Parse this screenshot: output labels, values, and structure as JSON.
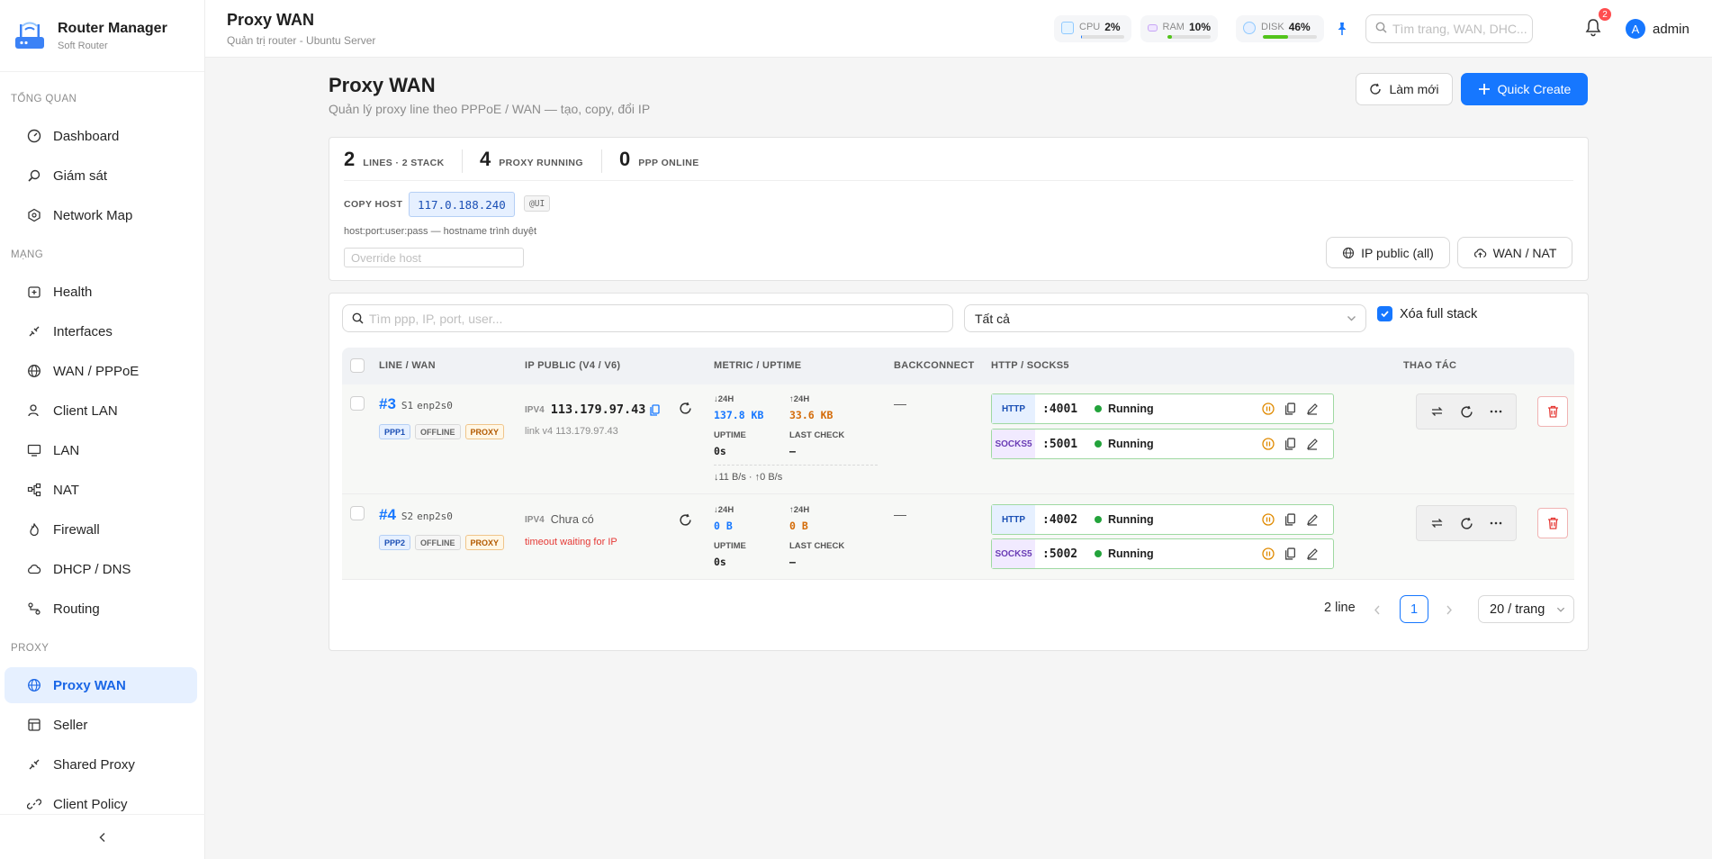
{
  "brand": {
    "title": "Router Manager",
    "subtitle": "Soft Router"
  },
  "sidebar": {
    "sections": [
      {
        "label": "TỔNG QUAN"
      },
      {
        "label": "MẠNG"
      },
      {
        "label": "PROXY"
      }
    ],
    "items": [
      {
        "label": "Dashboard",
        "icon": "dashboard-icon"
      },
      {
        "label": "Giám sát",
        "icon": "monitor-search-icon"
      },
      {
        "label": "Network Map",
        "icon": "network-map-icon"
      },
      {
        "label": "Health",
        "icon": "health-icon"
      },
      {
        "label": "Interfaces",
        "icon": "interfaces-icon"
      },
      {
        "label": "WAN / PPPoE",
        "icon": "globe-icon"
      },
      {
        "label": "Client LAN",
        "icon": "client-icon"
      },
      {
        "label": "LAN",
        "icon": "monitor-icon"
      },
      {
        "label": "NAT",
        "icon": "nat-icon"
      },
      {
        "label": "Firewall",
        "icon": "fire-icon"
      },
      {
        "label": "DHCP / DNS",
        "icon": "cloud-icon"
      },
      {
        "label": "Routing",
        "icon": "routing-icon"
      },
      {
        "label": "Proxy WAN",
        "icon": "globe-icon"
      },
      {
        "label": "Seller",
        "icon": "seller-icon"
      },
      {
        "label": "Shared Proxy",
        "icon": "shared-icon"
      },
      {
        "label": "Client Policy",
        "icon": "link-icon"
      }
    ],
    "active": "Proxy WAN"
  },
  "header": {
    "title": "Proxy WAN",
    "subtitle": "Quản trị router - Ubuntu Server",
    "stats": [
      {
        "label": "CPU",
        "value": "2%",
        "percent": 2,
        "color": "#1677ff"
      },
      {
        "label": "RAM",
        "value": "10%",
        "percent": 10,
        "color": "#52c41a"
      },
      {
        "label": "DISK",
        "value": "46%",
        "percent": 46,
        "color": "#52c41a"
      }
    ],
    "search_placeholder": "Tìm trang, WAN, DHC...",
    "notifications": "2",
    "avatar_letter": "A",
    "user": "admin"
  },
  "page": {
    "title": "Proxy WAN",
    "subtitle": "Quản lý proxy line theo PPPoE / WAN — tạo, copy, đổi IP",
    "refresh_label": "Làm mới",
    "quick_create_label": "Quick Create"
  },
  "summary": {
    "kpis": [
      {
        "value": "2",
        "label": "LINES · 2 STACK"
      },
      {
        "value": "4",
        "label": "PROXY RUNNING"
      },
      {
        "value": "0",
        "label": "PPP ONLINE"
      }
    ],
    "copy_host_label": "COPY HOST",
    "copy_host_value": "117.0.188.240",
    "ui_badge": "@UI",
    "hint": "host:port:user:pass — hostname trình duyệt",
    "override_placeholder": "Override host",
    "ip_public_label": "IP public (all)",
    "wan_nat_label": "WAN / NAT"
  },
  "filters": {
    "search_placeholder": "Tìm ppp, IP, port, user...",
    "select_value": "Tất cả",
    "full_stack_label": "Xóa full stack",
    "full_stack_checked": true
  },
  "table": {
    "columns": [
      "LINE / WAN",
      "IP PUBLIC (V4 / V6)",
      "METRIC / UPTIME",
      "BACKCONNECT",
      "HTTP / SOCKS5",
      "THAO TÁC"
    ],
    "rows": [
      {
        "id": "#3",
        "stack": "S1",
        "iface": "enp2s0",
        "tags": [
          "PPP1",
          "OFFLINE",
          "PROXY"
        ],
        "ip_label": "IPV4",
        "ip": "113.179.97.43",
        "ip_sub": "link v4 113.179.97.43",
        "down_label": "↓24H",
        "down": "137.8 KB",
        "up_label": "↑24H",
        "up": "33.6 KB",
        "uptime_label": "UPTIME",
        "uptime": "0s",
        "check_label": "LAST CHECK",
        "check": "–",
        "rate": "↓11 B/s · ↑0 B/s",
        "backconnect": "—",
        "proxies": [
          {
            "type": "HTTP",
            "port": ":4001",
            "status": "Running"
          },
          {
            "type": "SOCKS5",
            "port": ":5001",
            "status": "Running"
          }
        ]
      },
      {
        "id": "#4",
        "stack": "S2",
        "iface": "enp2s0",
        "tags": [
          "PPP2",
          "OFFLINE",
          "PROXY"
        ],
        "ip_label": "IPV4",
        "ip": "Chưa có",
        "ip_sub": "timeout waiting for IP",
        "down_label": "↓24H",
        "down": "0 B",
        "up_label": "↑24H",
        "up": "0 B",
        "uptime_label": "UPTIME",
        "uptime": "0s",
        "check_label": "LAST CHECK",
        "check": "–",
        "rate": "",
        "backconnect": "—",
        "proxies": [
          {
            "type": "HTTP",
            "port": ":4002",
            "status": "Running"
          },
          {
            "type": "SOCKS5",
            "port": ":5002",
            "status": "Running"
          }
        ]
      }
    ]
  },
  "pagination": {
    "total": "2 line",
    "current": "1",
    "page_size": "20 / trang"
  }
}
